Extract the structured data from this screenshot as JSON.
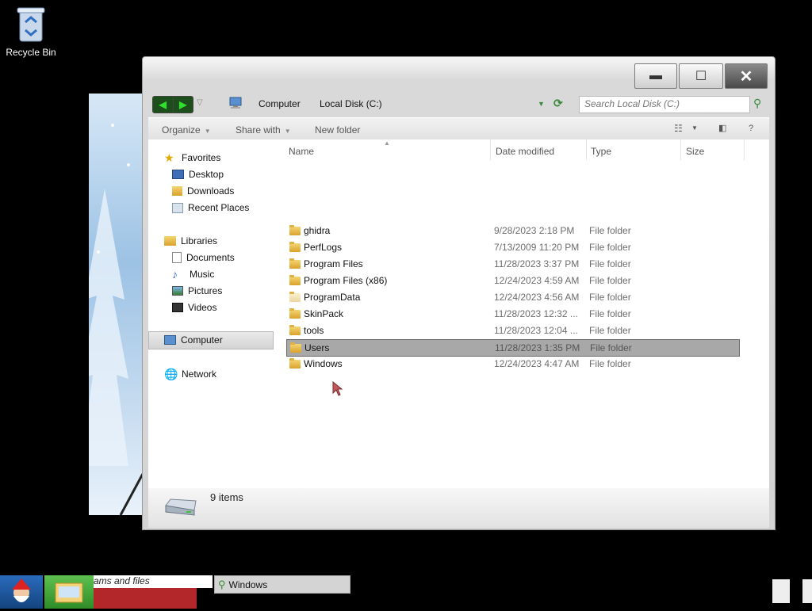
{
  "desktop": {
    "recycle_bin_label": "Recycle Bin"
  },
  "window": {
    "nav": {
      "back": "◀",
      "forward": "▶"
    },
    "breadcrumb": [
      "Computer",
      "Local Disk (C:)"
    ],
    "search_placeholder": "Search Local Disk (C:)",
    "toolbar": {
      "organize": "Organize",
      "share_with": "Share with",
      "new_folder": "New folder"
    },
    "sidebar": {
      "favorites": {
        "label": "Favorites",
        "items": [
          "Desktop",
          "Downloads",
          "Recent Places"
        ]
      },
      "libraries": {
        "label": "Libraries",
        "items": [
          "Documents",
          "Music",
          "Pictures",
          "Videos"
        ]
      },
      "computer": "Computer",
      "network": "Network"
    },
    "columns": {
      "name": "Name",
      "date": "Date modified",
      "type": "Type",
      "size": "Size"
    },
    "files": [
      {
        "name": "ghidra",
        "date": "9/28/2023 2:18 PM",
        "type": "File folder"
      },
      {
        "name": "PerfLogs",
        "date": "7/13/2009 11:20 PM",
        "type": "File folder"
      },
      {
        "name": "Program Files",
        "date": "11/28/2023 3:37 PM",
        "type": "File folder"
      },
      {
        "name": "Program Files (x86)",
        "date": "12/24/2023 4:59 AM",
        "type": "File folder"
      },
      {
        "name": "ProgramData",
        "date": "12/24/2023 4:56 AM",
        "type": "File folder"
      },
      {
        "name": "SkinPack",
        "date": "11/28/2023 12:32 ...",
        "type": "File folder"
      },
      {
        "name": "tools",
        "date": "11/28/2023 12:04 ...",
        "type": "File folder"
      },
      {
        "name": "Users",
        "date": "11/28/2023 1:35 PM",
        "type": "File folder",
        "selected": true
      },
      {
        "name": "Windows",
        "date": "12/24/2023 4:47 AM",
        "type": "File folder"
      }
    ],
    "status": {
      "item_count": "9 items"
    }
  },
  "taskbar": {
    "programs_text": "ams and files",
    "window_button": "Windows"
  }
}
